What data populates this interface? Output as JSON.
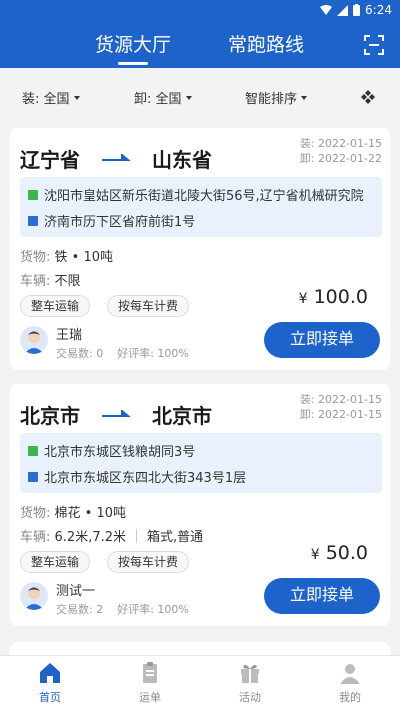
{
  "statusbar": {
    "time": "6:24"
  },
  "header": {
    "tabs": [
      {
        "label": "货源大厅",
        "active": true
      },
      {
        "label": "常跑路线",
        "active": false
      }
    ],
    "scan_icon": "scan-icon"
  },
  "filters": {
    "load": "装: 全国",
    "unload": "卸: 全国",
    "sort": "智能排序",
    "filter_icon": "filter-icon"
  },
  "cards": [
    {
      "from": "辽宁省",
      "to": "山东省",
      "load_date": "装: 2022-01-15",
      "unload_date": "卸: 2022-01-22",
      "load_address": "沈阳市皇姑区新乐街道北陵大街56号,辽宁省机械研究院",
      "unload_address": "济南市历下区省府前街1号",
      "goods_label": "货物:",
      "goods": "铁 • 10吨",
      "vehicle_label": "车辆:",
      "vehicle": "不限",
      "vehicle_type": "",
      "tags": [
        "整车运输",
        "按每车计费"
      ],
      "price_currency": "¥",
      "price": "100.0",
      "user_name": "王瑞",
      "deals": "交易数: 0",
      "rating": "好评率: 100%",
      "button": "立即接单"
    },
    {
      "from": "北京市",
      "to": "北京市",
      "load_date": "装: 2022-01-15",
      "unload_date": "卸: 2022-01-15",
      "load_address": "北京市东城区钱粮胡同3号",
      "unload_address": "北京市东城区东四北大街343号1层",
      "goods_label": "货物:",
      "goods": "棉花 • 10吨",
      "vehicle_label": "车辆:",
      "vehicle": "6.2米,7.2米",
      "vehicle_type": "箱式,普通",
      "tags": [
        "整车运输",
        "按每车计费"
      ],
      "price_currency": "¥",
      "price": "50.0",
      "user_name": "测试一",
      "deals": "交易数: 2",
      "rating": "好评率: 100%",
      "button": "立即接单"
    }
  ],
  "tabbar": {
    "items": [
      {
        "label": "首页",
        "icon": "home-icon",
        "active": true
      },
      {
        "label": "运单",
        "icon": "waybill-icon",
        "active": false
      },
      {
        "label": "活动",
        "icon": "gift-icon",
        "active": false
      },
      {
        "label": "我的",
        "icon": "user-icon",
        "active": false
      }
    ]
  },
  "colors": {
    "primary": "#1d63c9",
    "load_tag": "#3cb54a",
    "unload_tag": "#2c6bd6",
    "address_bg": "#e9f1fc"
  }
}
